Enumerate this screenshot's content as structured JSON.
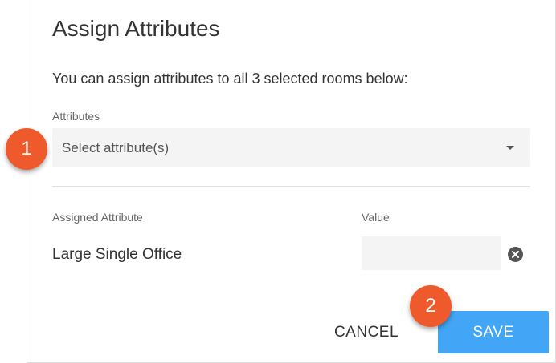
{
  "dialog": {
    "title": "Assign Attributes",
    "description": "You can assign attributes to all 3 selected rooms below:",
    "attributes_label": "Attributes",
    "attributes_placeholder": "Select attribute(s)",
    "columns": {
      "assigned": "Assigned Attribute",
      "value": "Value"
    },
    "rows": [
      {
        "name": "Large Single Office",
        "value": ""
      }
    ],
    "cancel_label": "CANCEL",
    "save_label": "SAVE"
  },
  "callouts": [
    "1",
    "2"
  ],
  "colors": {
    "accent": "#42a5f5",
    "callout": "#ee5a2b"
  }
}
